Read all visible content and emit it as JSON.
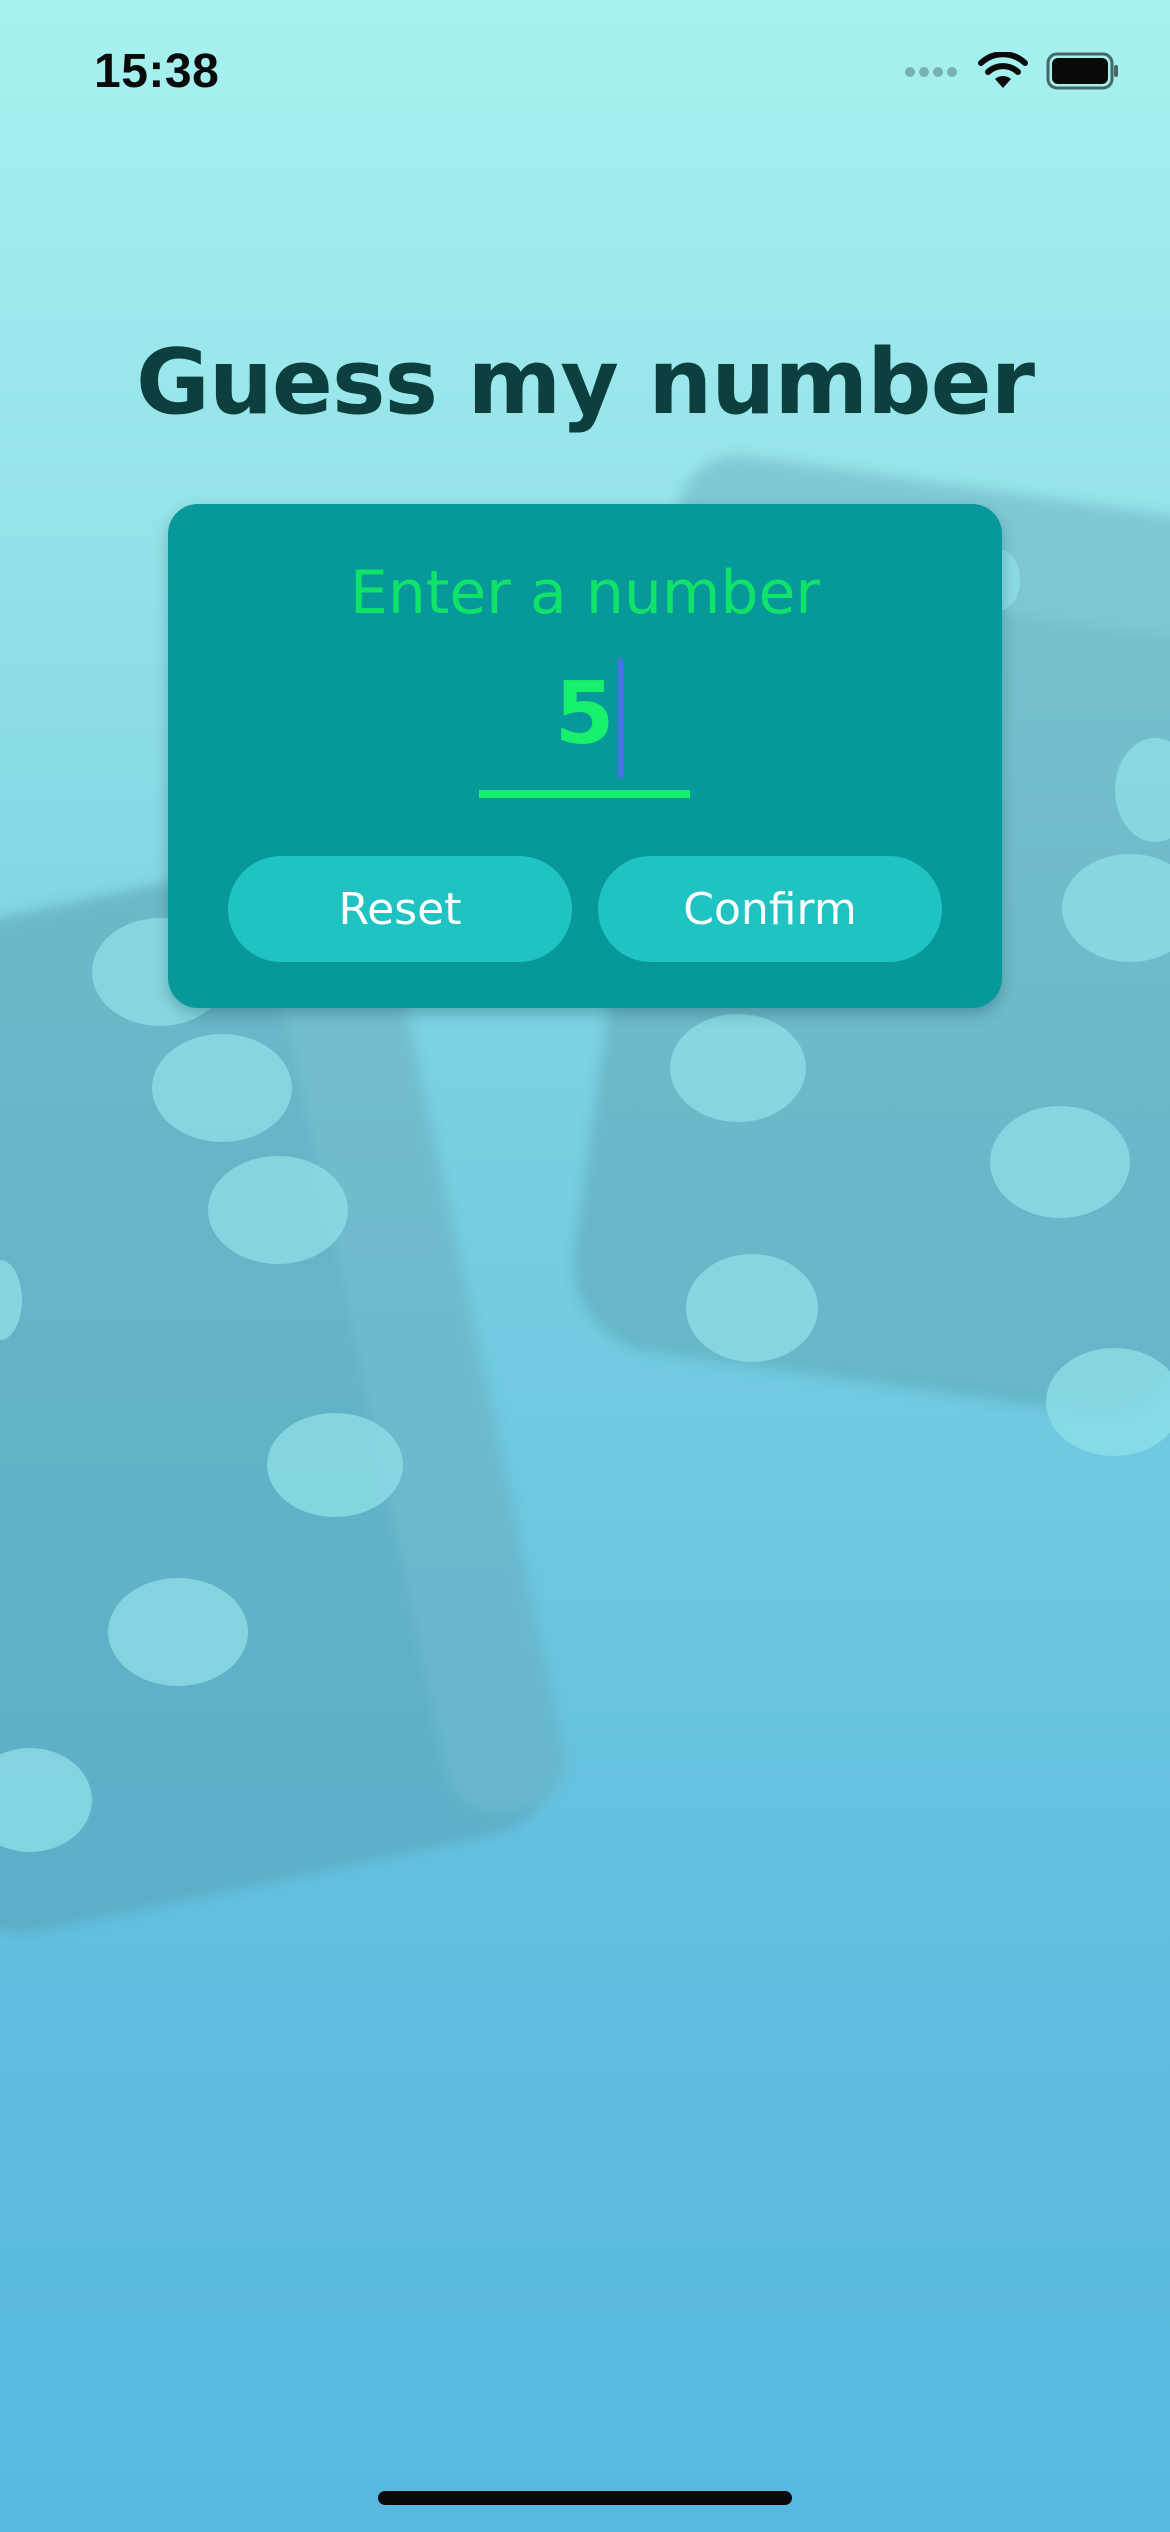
{
  "status_bar": {
    "time": "15:38",
    "icons": [
      "cellular-signal-icon",
      "wifi-icon",
      "battery-icon"
    ]
  },
  "title": "Guess my number",
  "card": {
    "label": "Enter a number",
    "input_value": "5",
    "buttons": {
      "reset_label": "Reset",
      "confirm_label": "Confirm"
    }
  },
  "colors": {
    "title": "#0c3f3d",
    "card_background": "#07989a",
    "accent_green": "#16f06a",
    "button_background": "#1fc4c2",
    "button_text": "#ffffff",
    "text_cursor": "#4a6fe8"
  }
}
